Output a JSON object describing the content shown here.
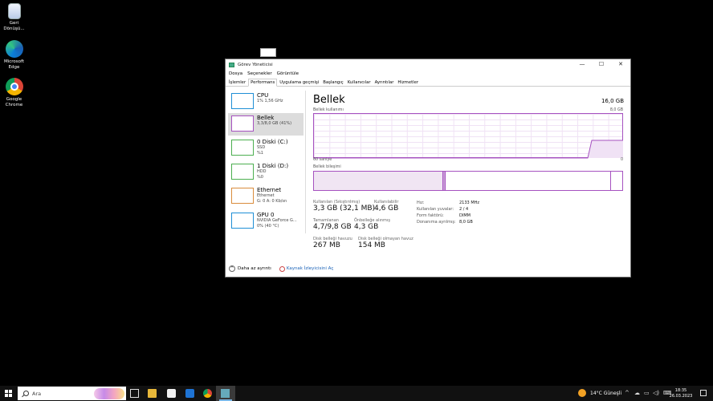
{
  "desktop": {
    "icons": [
      {
        "label": "Geri Dönüşü...",
        "icon": "recycle-bin-icon"
      },
      {
        "label": "Microsoft Edge",
        "icon": "edge-icon"
      },
      {
        "label": "Google Chrome",
        "icon": "chrome-icon"
      }
    ]
  },
  "window": {
    "title": "Görev Yöneticisi",
    "controls": {
      "minimize": "—",
      "maximize": "☐",
      "close": "✕"
    },
    "menu": [
      "Dosya",
      "Seçenekler",
      "Görüntüle"
    ],
    "tabs": [
      "İşlemler",
      "Performans",
      "Uygulama geçmişi",
      "Başlangıç",
      "Kullanıcılar",
      "Ayrıntılar",
      "Hizmetler"
    ],
    "active_tab": "Performans"
  },
  "sidebar": [
    {
      "name": "CPU",
      "sub1": "1%  1,56 GHz",
      "sub2": "",
      "color": "#1f8fd6",
      "selected": false
    },
    {
      "name": "Bellek",
      "sub1": "3,3/8,0 GB (41%)",
      "sub2": "",
      "color": "#a652c0",
      "selected": true
    },
    {
      "name": "0 Diski (C:)",
      "sub1": "SSD",
      "sub2": "%1",
      "color": "#4caf50",
      "selected": false
    },
    {
      "name": "1 Diski (D:)",
      "sub1": "HDD",
      "sub2": "%0",
      "color": "#4caf50",
      "selected": false
    },
    {
      "name": "Ethernet",
      "sub1": "Ethernet",
      "sub2": "G: 0 A: 0 Kb/sn",
      "color": "#d98c3c",
      "selected": false
    },
    {
      "name": "GPU 0",
      "sub1": "NVIDIA GeForce G...",
      "sub2": "0% (40 °C)",
      "color": "#1f8fd6",
      "selected": false
    }
  ],
  "memory": {
    "title": "Bellek",
    "total": "16,0 GB",
    "usage_label": "Bellek kullanımı",
    "usage_max": "8,0 GB",
    "time_label": "60 saniye",
    "time_zero": "0",
    "composition_label": "Bellek bileşimi",
    "stats": {
      "in_use_label": "Kullanılan (Sıkıştırılmış)",
      "in_use": "3,3 GB (32,1 MB)",
      "available_label": "Kullanılabilir",
      "available": "4,6 GB",
      "committed_label": "Tamamlanan",
      "committed": "4,7/9,8 GB",
      "cached_label": "Önbelleğe alınmış",
      "cached": "4,3 GB",
      "paged_label": "Disk belleği havuzu",
      "paged": "267 MB",
      "nonpaged_label": "Disk belleği olmayan havuz",
      "nonpaged": "154 MB"
    },
    "specs": [
      {
        "k": "Hız:",
        "v": "2133 MHz"
      },
      {
        "k": "Kullanılan yuvalar:",
        "v": "2 / 4"
      },
      {
        "k": "Form faktörü:",
        "v": "DIMM"
      },
      {
        "k": "Donanıma ayrılmış:",
        "v": "8,0 GB"
      }
    ]
  },
  "footer": {
    "fewer": "Daha az ayrıntı",
    "resmon": "Kaynak İzleyicisini Aç"
  },
  "taskbar": {
    "search_placeholder": "Ara",
    "weather": "14°C  Güneşli",
    "time": "18:35",
    "date": "26.03.2023"
  }
}
